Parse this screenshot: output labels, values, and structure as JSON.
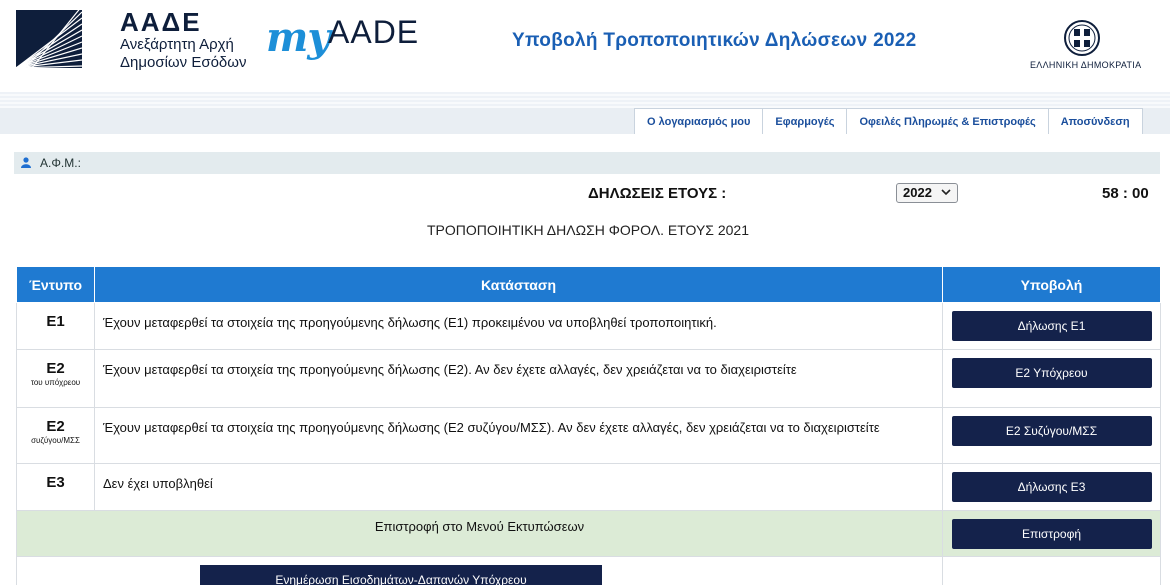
{
  "header": {
    "brand_abbr": "ΑΑΔΕ",
    "brand_line1": "Ανεξάρτητη Αρχή",
    "brand_line2": "Δημοσίων Εσόδων",
    "myaade_my": "my",
    "myaade_aade": "AADE",
    "page_heading": "Υποβολή Τροποποιητικών Δηλώσεων 2022",
    "gov_label": "ΕΛΛΗΝΙΚΗ ΔΗΜΟΚΡΑΤΙΑ"
  },
  "nav": {
    "items": [
      {
        "label": "Ο λογαριασμός μου"
      },
      {
        "label": "Εφαρμογές"
      },
      {
        "label": "Οφειλές Πληρωμές & Επιστροφές"
      },
      {
        "label": "Αποσύνδεση"
      }
    ]
  },
  "user": {
    "afm_label": "Α.Φ.Μ.:",
    "icon": "user-icon"
  },
  "year_row": {
    "label": "ΔΗΛΩΣΕΙΣ ΕΤΟΥΣ :",
    "selected_year": "2022",
    "timer": "58 : 00"
  },
  "subtitle": "ΤΡΟΠΟΠΟΙΗΤΙΚΗ ΔΗΛΩΣΗ ΦΟΡΟΛ. ΕΤΟΥΣ 2021",
  "table": {
    "headers": {
      "form": "Έντυπο",
      "status": "Κατάσταση",
      "submit": "Υποβολή"
    },
    "rows": [
      {
        "code": "E1",
        "sub": "",
        "status": "Έχουν μεταφερθεί τα στοιχεία της προηγούμενης δήλωσης (Ε1) προκειμένου να υποβληθεί τροποποιητική.",
        "button": "Δήλωσης Ε1"
      },
      {
        "code": "E2",
        "sub": "του υπόχρεου",
        "status": "Έχουν μεταφερθεί τα στοιχεία της προηγούμενης δήλωσης (Ε2). Αν δεν έχετε αλλαγές, δεν χρειάζεται να το διαχειριστείτε",
        "button": "Ε2 Υπόχρεου"
      },
      {
        "code": "E2",
        "sub": "συζύγου/ΜΣΣ",
        "status": "Έχουν μεταφερθεί τα στοιχεία της προηγούμενης δήλωσης (Ε2 συζύγου/ΜΣΣ). Αν δεν έχετε αλλαγές, δεν χρειάζεται να το διαχειριστείτε",
        "button": "Ε2 Συζύγου/ΜΣΣ"
      },
      {
        "code": "E3",
        "sub": "",
        "status": "Δεν έχει υποβληθεί",
        "button": "Δήλωσης Ε3"
      }
    ],
    "return_row": {
      "label": "Επιστροφή στο Μενού Εκτυπώσεων",
      "button": "Επιστροφή"
    },
    "bottom_button": "Ενημέρωση Εισοδημάτων-Δαπανών Υπόχρεου"
  },
  "colors": {
    "header_blue": "#1f7ad1",
    "button_navy": "#14224b",
    "heading_blue": "#1a5fb4",
    "return_row_green": "#dcebd6"
  }
}
